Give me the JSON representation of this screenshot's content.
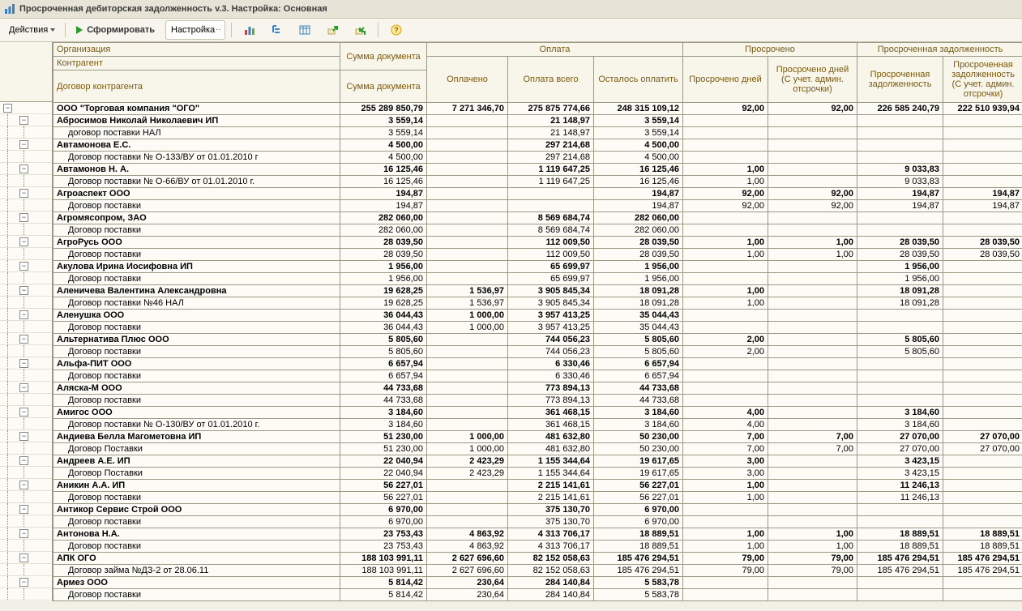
{
  "window": {
    "title": "Просроченная дебиторская задолженность v.3. Настройка: Основная"
  },
  "toolbar": {
    "actions": "Действия",
    "run": "Сформировать",
    "settings": "Настройка"
  },
  "headers": {
    "org": "Организация",
    "sumdoc": "Сумма документа",
    "pay_group": "Оплата",
    "over_group": "Просрочено",
    "debt_group": "Просроченная задолженность",
    "partner": "Контрагент",
    "paid": "Оплачено",
    "paid_total": "Оплата всего",
    "remain": "Осталось оплатить",
    "over_days": "Просрочено дней",
    "over_days_adm": "Просрочено дней (С учет. админ. отсрочки)",
    "debt": "Просроченная задолженность",
    "debt_adm": "Просроченная задолженность (С учет. админ. отсрочки)",
    "contract": "Договор контрагента"
  },
  "rows": [
    {
      "lvl": 0,
      "name": "ООО \"Торговая компания \"ОГО\"",
      "sum": "255 289 850,79",
      "c1": "7 271 346,70",
      "c2": "275 875 774,66",
      "c3": "248 315 109,12",
      "c4": "92,00",
      "c5": "92,00",
      "c6": "226 585 240,79",
      "c7": "222 510 939,94"
    },
    {
      "lvl": 1,
      "name": "Абросимов Николай Николаевич ИП",
      "sum": "3 559,14",
      "c2": "21 148,97",
      "c3": "3 559,14"
    },
    {
      "lvl": 2,
      "name": "договор поставки НАЛ",
      "sum": "3 559,14",
      "c2": "21 148,97",
      "c3": "3 559,14"
    },
    {
      "lvl": 1,
      "name": "Автамонова Е.С.",
      "sum": "4 500,00",
      "c2": "297 214,68",
      "c3": "4 500,00"
    },
    {
      "lvl": 2,
      "name": "Договор поставки № О-133/ВУ от 01.01.2010 г",
      "sum": "4 500,00",
      "c2": "297 214,68",
      "c3": "4 500,00"
    },
    {
      "lvl": 1,
      "name": "Автамонов Н. А.",
      "sum": "16 125,46",
      "c2": "1 119 647,25",
      "c3": "16 125,46",
      "c4": "1,00",
      "c6": "9 033,83"
    },
    {
      "lvl": 2,
      "name": "Договор поставки № О-66/ВУ от 01.01.2010 г.",
      "sum": "16 125,46",
      "c2": "1 119 647,25",
      "c3": "16 125,46",
      "c4": "1,00",
      "c6": "9 033,83"
    },
    {
      "lvl": 1,
      "name": "Агроаспект ООО",
      "sum": "194,87",
      "c3": "194,87",
      "c4": "92,00",
      "c5": "92,00",
      "c6": "194,87",
      "c7": "194,87"
    },
    {
      "lvl": 2,
      "name": "Договор поставки",
      "sum": "194,87",
      "c3": "194,87",
      "c4": "92,00",
      "c5": "92,00",
      "c6": "194,87",
      "c7": "194,87"
    },
    {
      "lvl": 1,
      "name": "Агромясопром, ЗАО",
      "sum": "282 060,00",
      "c2": "8 569 684,74",
      "c3": "282 060,00"
    },
    {
      "lvl": 2,
      "name": "Договор поставки",
      "sum": "282 060,00",
      "c2": "8 569 684,74",
      "c3": "282 060,00"
    },
    {
      "lvl": 1,
      "name": "АгроРусь ООО",
      "sum": "28 039,50",
      "c2": "112 009,50",
      "c3": "28 039,50",
      "c4": "1,00",
      "c5": "1,00",
      "c6": "28 039,50",
      "c7": "28 039,50"
    },
    {
      "lvl": 2,
      "name": "Договор поставки",
      "sum": "28 039,50",
      "c2": "112 009,50",
      "c3": "28 039,50",
      "c4": "1,00",
      "c5": "1,00",
      "c6": "28 039,50",
      "c7": "28 039,50"
    },
    {
      "lvl": 1,
      "name": "Акулова Ирина Иосифовна ИП",
      "sum": "1 956,00",
      "c2": "65 699,97",
      "c3": "1 956,00",
      "c6": "1 956,00"
    },
    {
      "lvl": 2,
      "name": "Договор поставки",
      "sum": "1 956,00",
      "c2": "65 699,97",
      "c3": "1 956,00",
      "c6": "1 956,00"
    },
    {
      "lvl": 1,
      "name": "Аленичева Валентина Александровна",
      "sum": "19 628,25",
      "c1": "1 536,97",
      "c2": "3 905 845,34",
      "c3": "18 091,28",
      "c4": "1,00",
      "c6": "18 091,28"
    },
    {
      "lvl": 2,
      "name": "Договор поставки №46 НАЛ",
      "sum": "19 628,25",
      "c1": "1 536,97",
      "c2": "3 905 845,34",
      "c3": "18 091,28",
      "c4": "1,00",
      "c6": "18 091,28"
    },
    {
      "lvl": 1,
      "name": "Аленушка ООО",
      "sum": "36 044,43",
      "c1": "1 000,00",
      "c2": "3 957 413,25",
      "c3": "35 044,43"
    },
    {
      "lvl": 2,
      "name": "Договор поставки",
      "sum": "36 044,43",
      "c1": "1 000,00",
      "c2": "3 957 413,25",
      "c3": "35 044,43"
    },
    {
      "lvl": 1,
      "name": "Альтернатива Плюс ООО",
      "sum": "5 805,60",
      "c2": "744 056,23",
      "c3": "5 805,60",
      "c4": "2,00",
      "c6": "5 805,60"
    },
    {
      "lvl": 2,
      "name": "Договор поставки",
      "sum": "5 805,60",
      "c2": "744 056,23",
      "c3": "5 805,60",
      "c4": "2,00",
      "c6": "5 805,60"
    },
    {
      "lvl": 1,
      "name": "Альфа-ПИТ ООО",
      "sum": "6 657,94",
      "c2": "6 330,46",
      "c3": "6 657,94"
    },
    {
      "lvl": 2,
      "name": "Договор поставки",
      "sum": "6 657,94",
      "c2": "6 330,46",
      "c3": "6 657,94"
    },
    {
      "lvl": 1,
      "name": "Аляска-М ООО",
      "sum": "44 733,68",
      "c2": "773 894,13",
      "c3": "44 733,68"
    },
    {
      "lvl": 2,
      "name": "Договор поставки",
      "sum": "44 733,68",
      "c2": "773 894,13",
      "c3": "44 733,68"
    },
    {
      "lvl": 1,
      "name": "Амигос ООО",
      "sum": "3 184,60",
      "c2": "361 468,15",
      "c3": "3 184,60",
      "c4": "4,00",
      "c6": "3 184,60"
    },
    {
      "lvl": 2,
      "name": "Договор поставки № О-130/ВУ от 01.01.2010 г.",
      "sum": "3 184,60",
      "c2": "361 468,15",
      "c3": "3 184,60",
      "c4": "4,00",
      "c6": "3 184,60"
    },
    {
      "lvl": 1,
      "name": "Андиева Белла Магометовна ИП",
      "sum": "51 230,00",
      "c1": "1 000,00",
      "c2": "481 632,80",
      "c3": "50 230,00",
      "c4": "7,00",
      "c5": "7,00",
      "c6": "27 070,00",
      "c7": "27 070,00"
    },
    {
      "lvl": 2,
      "name": "Договор Поставки",
      "sum": "51 230,00",
      "c1": "1 000,00",
      "c2": "481 632,80",
      "c3": "50 230,00",
      "c4": "7,00",
      "c5": "7,00",
      "c6": "27 070,00",
      "c7": "27 070,00"
    },
    {
      "lvl": 1,
      "name": "Андреев А.Е. ИП",
      "sum": "22 040,94",
      "c1": "2 423,29",
      "c2": "1 155 344,64",
      "c3": "19 617,65",
      "c4": "3,00",
      "c6": "3 423,15"
    },
    {
      "lvl": 2,
      "name": "Договор Поставки",
      "sum": "22 040,94",
      "c1": "2 423,29",
      "c2": "1 155 344,64",
      "c3": "19 617,65",
      "c4": "3,00",
      "c6": "3 423,15"
    },
    {
      "lvl": 1,
      "name": "Аникин А.А. ИП",
      "sum": "56 227,01",
      "c2": "2 215 141,61",
      "c3": "56 227,01",
      "c4": "1,00",
      "c6": "11 246,13"
    },
    {
      "lvl": 2,
      "name": "Договор поставки",
      "sum": "56 227,01",
      "c2": "2 215 141,61",
      "c3": "56 227,01",
      "c4": "1,00",
      "c6": "11 246,13"
    },
    {
      "lvl": 1,
      "name": "Антикор Сервис Строй ООО",
      "sum": "6 970,00",
      "c2": "375 130,70",
      "c3": "6 970,00"
    },
    {
      "lvl": 2,
      "name": "Договор поставки",
      "sum": "6 970,00",
      "c2": "375 130,70",
      "c3": "6 970,00"
    },
    {
      "lvl": 1,
      "name": "Антонова Н.А.",
      "sum": "23 753,43",
      "c1": "4 863,92",
      "c2": "4 313 706,17",
      "c3": "18 889,51",
      "c4": "1,00",
      "c5": "1,00",
      "c6": "18 889,51",
      "c7": "18 889,51"
    },
    {
      "lvl": 2,
      "name": "Договор поставки",
      "sum": "23 753,43",
      "c1": "4 863,92",
      "c2": "4 313 706,17",
      "c3": "18 889,51",
      "c4": "1,00",
      "c5": "1,00",
      "c6": "18 889,51",
      "c7": "18 889,51"
    },
    {
      "lvl": 1,
      "name": "АПК ОГО",
      "sum": "188 103 991,11",
      "c1": "2 627 696,60",
      "c2": "82 152 058,63",
      "c3": "185 476 294,51",
      "c4": "79,00",
      "c5": "79,00",
      "c6": "185 476 294,51",
      "c7": "185 476 294,51"
    },
    {
      "lvl": 2,
      "name": "Договор займа №ДЗ-2 от 28.06.11",
      "sum": "188 103 991,11",
      "c1": "2 627 696,60",
      "c2": "82 152 058,63",
      "c3": "185 476 294,51",
      "c4": "79,00",
      "c5": "79,00",
      "c6": "185 476 294,51",
      "c7": "185 476 294,51"
    },
    {
      "lvl": 1,
      "name": "Армез ООО",
      "sum": "5 814,42",
      "c1": "230,64",
      "c2": "284 140,84",
      "c3": "5 583,78"
    },
    {
      "lvl": 2,
      "name": "Договор поставки",
      "sum": "5 814,42",
      "c1": "230,64",
      "c2": "284 140,84",
      "c3": "5 583,78"
    }
  ]
}
